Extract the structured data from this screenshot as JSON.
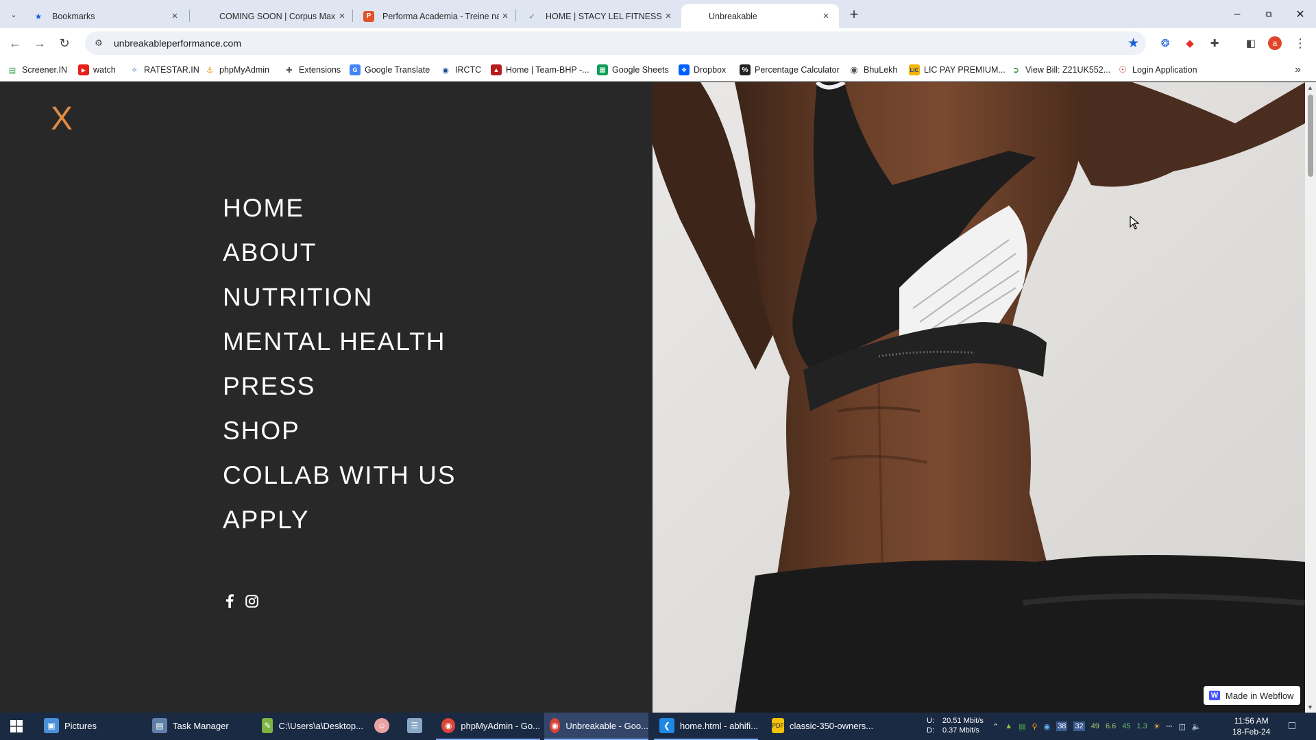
{
  "browser": {
    "tabs": [
      {
        "title": "Bookmarks",
        "favicon": "bookmark-star-icon",
        "active": false
      },
      {
        "title": "COMING SOON | Corpus Maxin",
        "favicon": "corpus-favicon",
        "active": false
      },
      {
        "title": "Performa Academia - Treine na",
        "favicon": "performa-favicon",
        "active": false
      },
      {
        "title": "HOME | STACY LEL FITNESS",
        "favicon": "stacy-favicon",
        "active": false
      },
      {
        "title": "Unbreakable",
        "favicon": "none",
        "active": true
      }
    ],
    "url": "unbreakableperformance.com",
    "profile_initial": "a",
    "bookmarks": [
      {
        "label": "Screener.IN",
        "icon": "bar-chart-icon",
        "color": "#2e9e44"
      },
      {
        "label": "watch",
        "icon": "youtube-icon",
        "color": "#e62117"
      },
      {
        "label": "RATESTAR.IN",
        "icon": "ratestar-icon",
        "color": "#3a6fb5"
      },
      {
        "label": "phpMyAdmin",
        "icon": "phpmyadmin-icon",
        "color": "#f29111"
      },
      {
        "label": "Extensions",
        "icon": "puzzle-icon",
        "color": "#555555"
      },
      {
        "label": "Google Translate",
        "icon": "translate-icon",
        "color": "#4285f4"
      },
      {
        "label": "IRCTC",
        "icon": "irctc-icon",
        "color": "#1d4f91"
      },
      {
        "label": "Home | Team-BHP -...",
        "icon": "teambhp-icon",
        "color": "#b71c1c"
      },
      {
        "label": "Google Sheets",
        "icon": "sheets-icon",
        "color": "#0f9d58"
      },
      {
        "label": "Dropbox",
        "icon": "dropbox-icon",
        "color": "#0061fe"
      },
      {
        "label": "Percentage Calculator",
        "icon": "percent-icon",
        "color": "#222222"
      },
      {
        "label": "BhuLekh",
        "icon": "bhulekh-icon",
        "color": "#555555"
      },
      {
        "label": "LIC PAY PREMIUM...",
        "icon": "lic-icon",
        "color": "#f5b400"
      },
      {
        "label": "View Bill: Z21UK552...",
        "icon": "bill-icon",
        "color": "#2a8d3f"
      },
      {
        "label": "Login Application",
        "icon": "login-icon",
        "color": "#d33a2c"
      }
    ]
  },
  "page": {
    "close_label": "X",
    "accent_color": "#e08a43",
    "nav_items": [
      "HOME",
      "ABOUT",
      "NUTRITION",
      "MENTAL HEALTH",
      "PRESS",
      "SHOP",
      "COLLAB WITH US",
      "APPLY"
    ],
    "social": [
      {
        "icon": "facebook-icon"
      },
      {
        "icon": "instagram-icon"
      }
    ],
    "hero_image": "athlete-torso-photo",
    "badge_label": "Made in Webflow"
  },
  "taskbar": {
    "items": [
      {
        "label": "Pictures",
        "icon": "pictures-icon",
        "state": "normal"
      },
      {
        "label": "Task Manager",
        "icon": "task-manager-icon",
        "state": "normal"
      },
      {
        "label": "C:\\Users\\a\\Desktop...",
        "icon": "notepad-icon",
        "state": "normal"
      },
      {
        "label": "",
        "icon": "app-icon",
        "state": "normal"
      },
      {
        "label": "",
        "icon": "document-icon",
        "state": "normal"
      },
      {
        "label": "phpMyAdmin - Go...",
        "icon": "chrome-icon",
        "state": "open"
      },
      {
        "label": "Unbreakable - Goo...",
        "icon": "chrome-icon",
        "state": "active"
      },
      {
        "label": "home.html - abhifi...",
        "icon": "vscode-icon",
        "state": "open"
      },
      {
        "label": "classic-350-owners...",
        "icon": "pdf-icon",
        "state": "normal"
      }
    ],
    "net_up_label": "U:",
    "net_up": "20.51 Mbit/s",
    "net_down_label": "D:",
    "net_down": "0.37 Mbit/s",
    "tray_numbers": [
      "38",
      "32",
      "49",
      "6.6",
      "45",
      "1.3"
    ],
    "time": "11:56 AM",
    "date": "18-Feb-24"
  }
}
